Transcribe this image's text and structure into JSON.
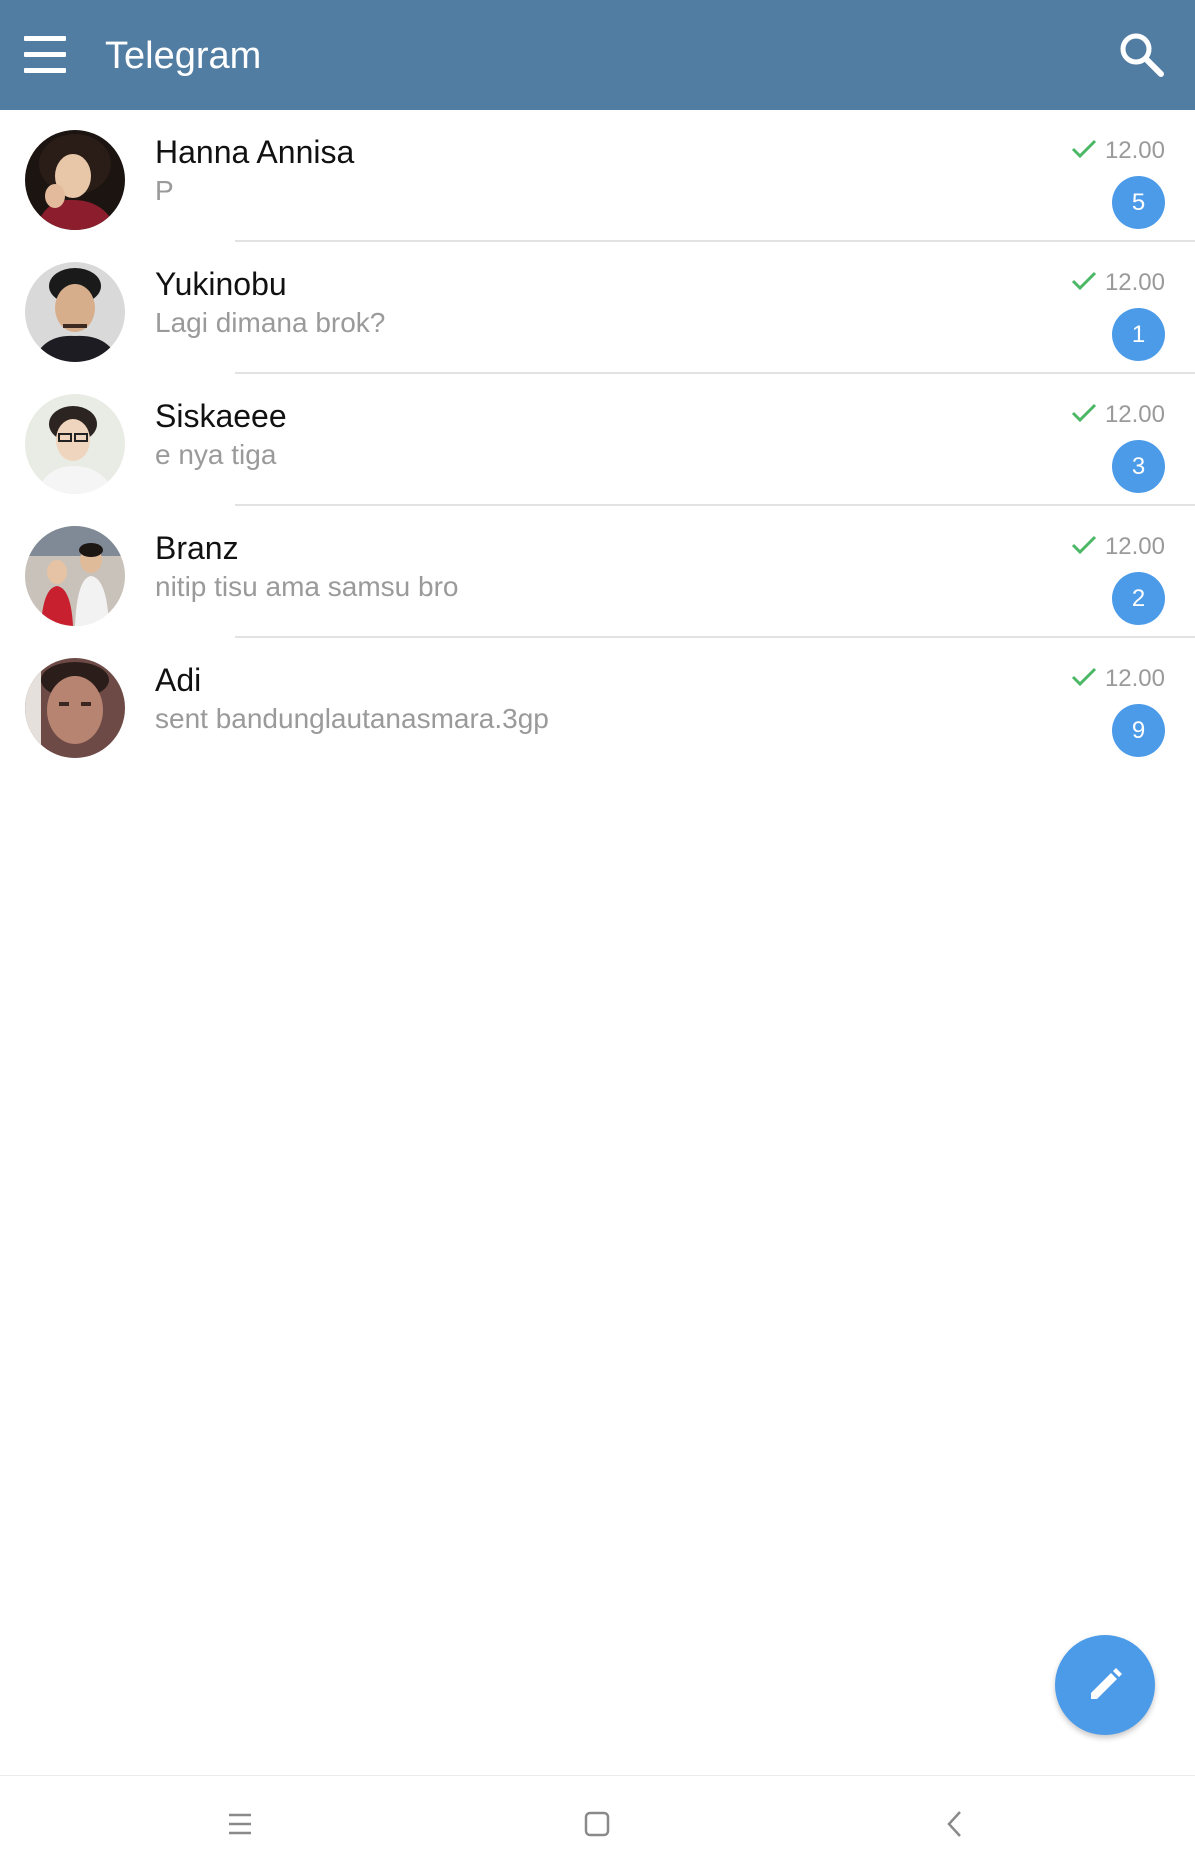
{
  "header": {
    "title": "Telegram",
    "menu_icon": "hamburger-menu-icon",
    "search_icon": "search-icon",
    "background_color": "#527da3"
  },
  "chats": [
    {
      "name": "Hanna Annisa",
      "preview": "P",
      "time": "12.00",
      "unread": "5",
      "status_icon": "check-icon",
      "avatar_icon": "avatar-photo"
    },
    {
      "name": "Yukinobu",
      "preview": "Lagi dimana brok?",
      "time": "12.00",
      "unread": "1",
      "status_icon": "check-icon",
      "avatar_icon": "avatar-photo"
    },
    {
      "name": "Siskaeee",
      "preview": "e nya tiga",
      "time": "12.00",
      "unread": "3",
      "status_icon": "check-icon",
      "avatar_icon": "avatar-photo"
    },
    {
      "name": "Branz",
      "preview": "nitip tisu ama samsu bro",
      "time": "12.00",
      "unread": "2",
      "status_icon": "check-icon",
      "avatar_icon": "avatar-photo"
    },
    {
      "name": "Adi",
      "preview": "sent bandunglautanasmara.3gp",
      "time": "12.00",
      "unread": "9",
      "status_icon": "check-icon",
      "avatar_icon": "avatar-photo"
    }
  ],
  "fab": {
    "icon": "pencil-icon",
    "color": "#4b9be9"
  },
  "nav": {
    "recents_icon": "recents-icon",
    "home_icon": "home-icon",
    "back_icon": "back-icon"
  },
  "colors": {
    "accent": "#4b9be9",
    "check": "#4cb866",
    "secondary_text": "#9a9a9a"
  }
}
